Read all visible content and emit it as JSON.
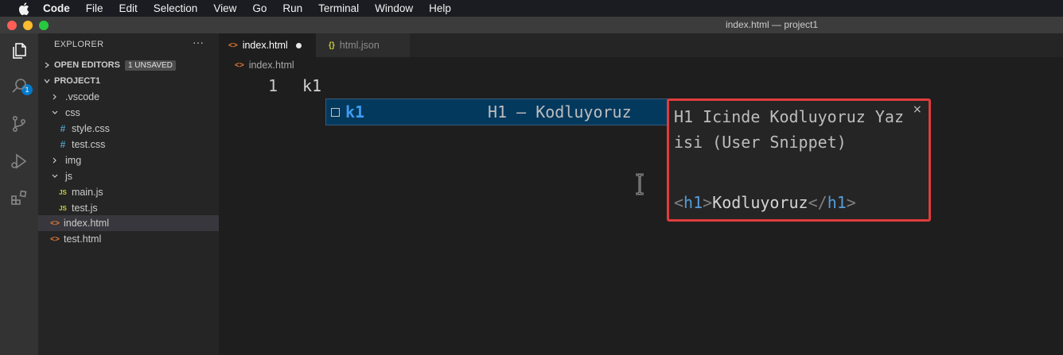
{
  "menubar": {
    "app": "Code",
    "items": [
      "File",
      "Edit",
      "Selection",
      "View",
      "Go",
      "Run",
      "Terminal",
      "Window",
      "Help"
    ]
  },
  "window": {
    "title": "index.html — project1"
  },
  "activity_bar": {
    "explorer_badge": "1"
  },
  "sidebar": {
    "title": "EXPLORER",
    "more": "···",
    "open_editors": {
      "label": "OPEN EDITORS",
      "badge": "1 UNSAVED"
    },
    "project": {
      "label": "PROJECT1"
    },
    "tree": [
      {
        "name": ".vscode"
      },
      {
        "name": "css"
      },
      {
        "name": "style.css",
        "icon": "#"
      },
      {
        "name": "test.css",
        "icon": "#"
      },
      {
        "name": "img"
      },
      {
        "name": "js"
      },
      {
        "name": "main.js",
        "icon": "JS"
      },
      {
        "name": "test.js",
        "icon": "JS"
      },
      {
        "name": "index.html",
        "icon": "<>"
      },
      {
        "name": "test.html",
        "icon": "<>"
      }
    ]
  },
  "editor": {
    "tabs": [
      {
        "label": "index.html",
        "icon": "<>"
      },
      {
        "label": "html.json",
        "icon": "{}"
      }
    ],
    "breadcrumb": "index.html",
    "line_number": "1",
    "line_text": "k1",
    "suggestion": {
      "label": "k1",
      "detail": "H1 – Kodluyoruz"
    },
    "details": {
      "description": "H1 Icinde Kodluyoruz Yazisi (User Snippet)",
      "open_tag": "<",
      "tag_name": "h1",
      "tag_close": ">",
      "content": "Kodluyoruz",
      "end_open": "</",
      "end_name": "h1",
      "end_close": ">",
      "close": "×"
    }
  }
}
